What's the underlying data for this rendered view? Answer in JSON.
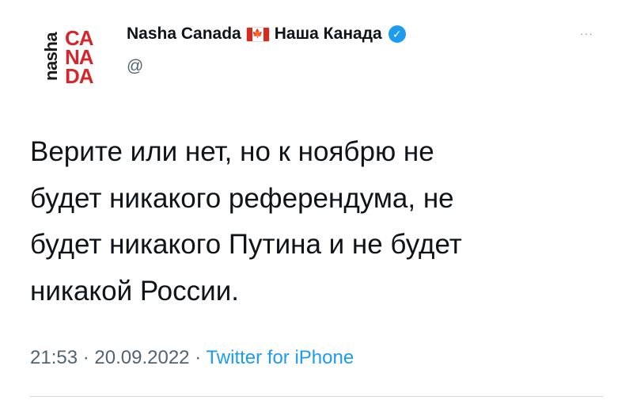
{
  "tweet": {
    "avatar": {
      "side_text": "nasha",
      "stack_text": [
        "CA",
        "NA",
        "DA"
      ]
    },
    "author": {
      "name_en": "Nasha Canada",
      "flag_icon": "canada-flag-icon",
      "name_ru": "Наша Канада",
      "verified": true,
      "handle": "@"
    },
    "more_icon": "···",
    "text_lines": [
      "Верите или нет, но к ноябрю не",
      "будет никакого референдума, не",
      "будет никакого Путина и не будет",
      "никакой России."
    ],
    "meta": {
      "time": "21:53",
      "sep1": "·",
      "date": "20.09.2022",
      "sep2": "·",
      "source": "Twitter for iPhone"
    },
    "colors": {
      "text": "#0f1419",
      "secondary": "#536471",
      "link": "#1d9bf0",
      "brand_red": "#d7262b"
    }
  }
}
